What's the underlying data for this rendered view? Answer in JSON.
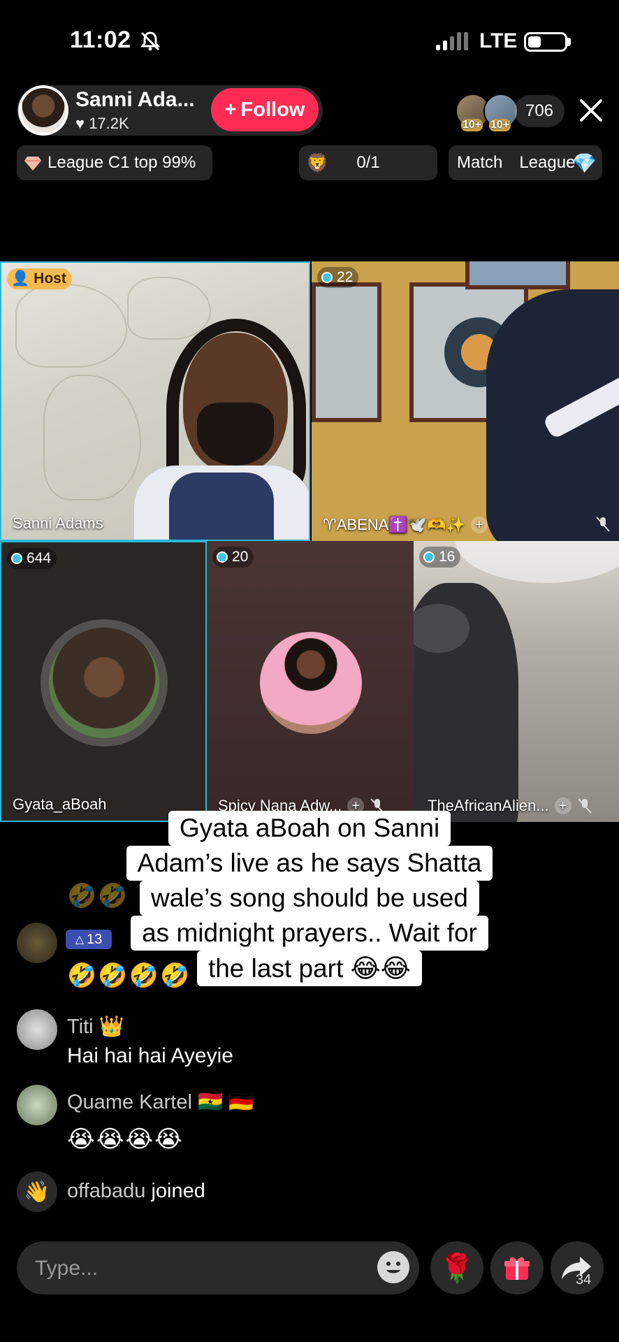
{
  "status": {
    "time": "11:02",
    "network": "LTE"
  },
  "host": {
    "name": "Sanni Ada...",
    "likes": "17.2K",
    "follow_label": "Follow"
  },
  "viewers": {
    "avatar_badges": [
      "10+",
      "10+"
    ],
    "count": "706"
  },
  "chips": {
    "league": "League C1 top 99%",
    "score": "0/1",
    "match": "Match",
    "league_short": "League"
  },
  "tiles": [
    {
      "badge": "Host",
      "name": "Sanni Adams"
    },
    {
      "badge": "22",
      "name": "♈ABENA✝️🕊️🫶✨"
    },
    {
      "badge": "644",
      "name": "Gyata_aBoah"
    },
    {
      "badge": "20",
      "name": "Spicy Nana Adw..."
    },
    {
      "badge": "16",
      "name": "TheAfricanAlien..."
    }
  ],
  "caption": {
    "lines": [
      "Gyata aBoah on Sanni",
      "Adam’s live as he says Shatta",
      "wale’s song should be used",
      "as midnight prayers.. Wait for",
      "the last part 😂😂"
    ]
  },
  "chat": [
    {
      "level": "13",
      "message": "🤣🤣🤣🤣"
    },
    {
      "name": "Titi 👑",
      "message": "Hai hai hai Ayeyie"
    },
    {
      "name": "Quame Kartel 🇬🇭 🇩🇪",
      "message": "😭😭😭😭"
    },
    {
      "name": "offabadu",
      "action": "joined"
    }
  ],
  "input": {
    "placeholder": "Type..."
  },
  "share": {
    "count": "34"
  },
  "colors": {
    "follow": "#fe2c55",
    "tile_border": "#2bb8d6",
    "host_badge": "#fab43c"
  }
}
